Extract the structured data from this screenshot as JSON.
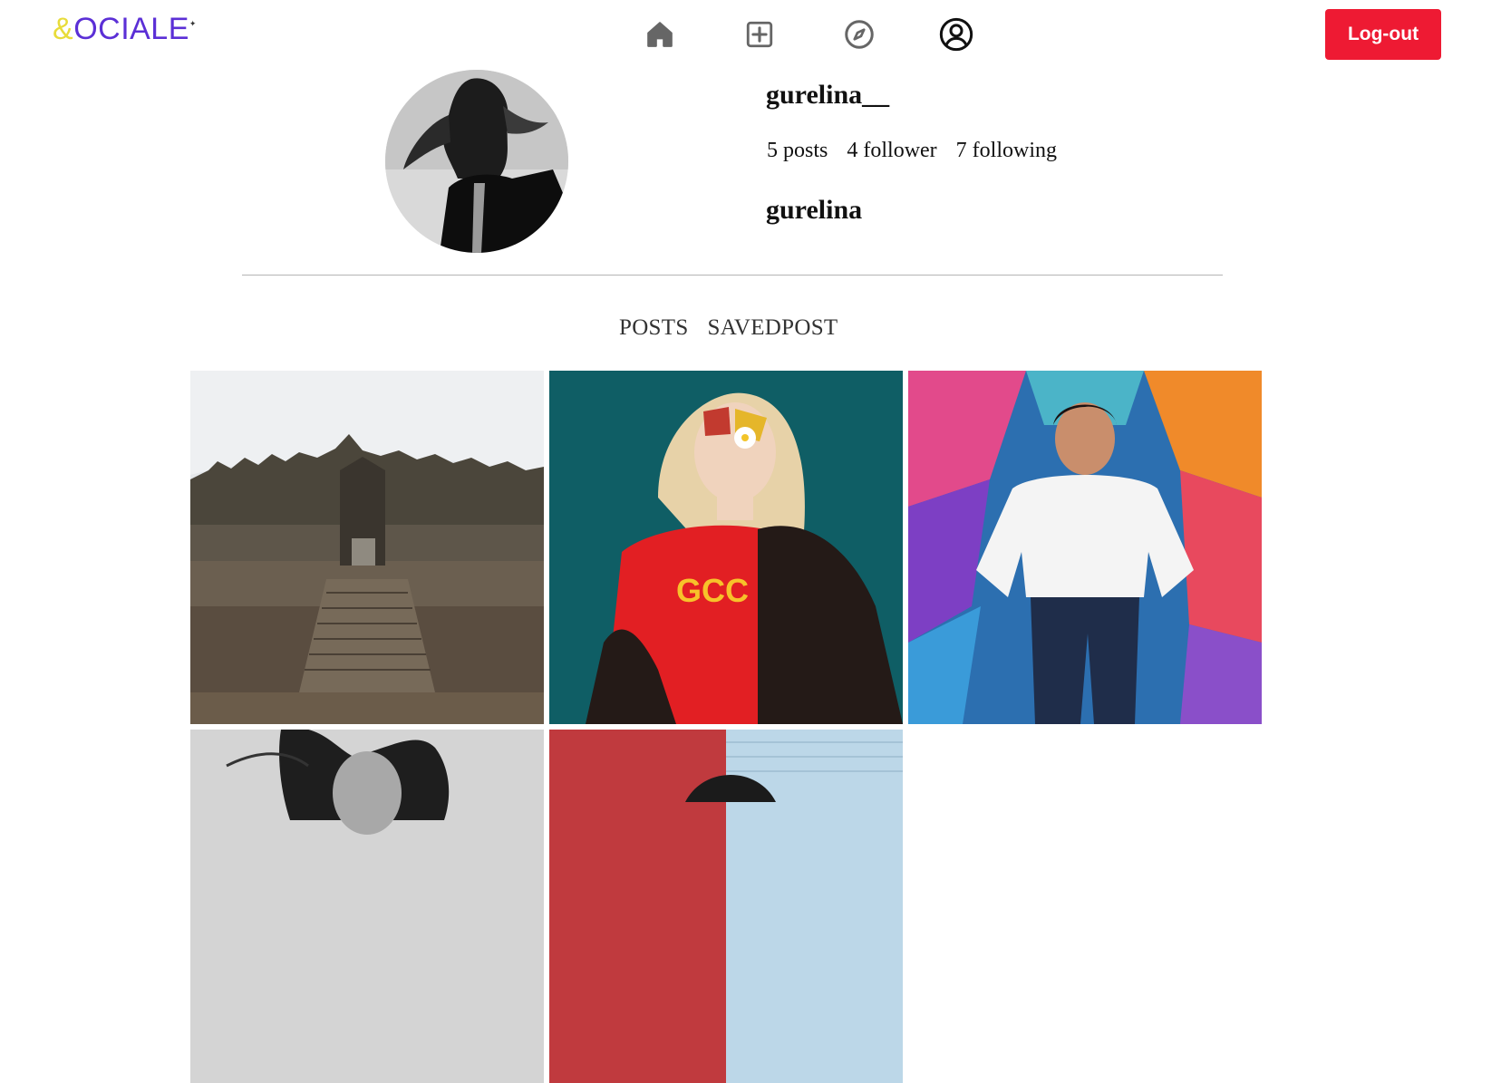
{
  "brand": {
    "amp": "&",
    "word": "OCIALE",
    "star": "✦"
  },
  "nav": {
    "icons": [
      "home-icon",
      "add-post-icon",
      "explore-icon",
      "profile-icon"
    ],
    "logout_label": "Log-out"
  },
  "profile": {
    "username": "gurelina__",
    "posts": "5 posts",
    "followers": "4 follower",
    "following": "7 following",
    "display_name": "gurelina"
  },
  "tabs": [
    "POSTS",
    "SAVEDPOST"
  ],
  "posts": [
    {
      "subject": "ancient temple stairs"
    },
    {
      "subject": "woman in sunglasses with daisy"
    },
    {
      "subject": "smiling woman at graffiti wall"
    },
    {
      "subject": "black and white portrait"
    },
    {
      "subject": "red and blue wall"
    }
  ],
  "colors": {
    "accent": "#5b2fd6",
    "logo_amp": "#e8dc3a",
    "logout_bg": "#ee1a33",
    "nav_icon": "#666666"
  }
}
